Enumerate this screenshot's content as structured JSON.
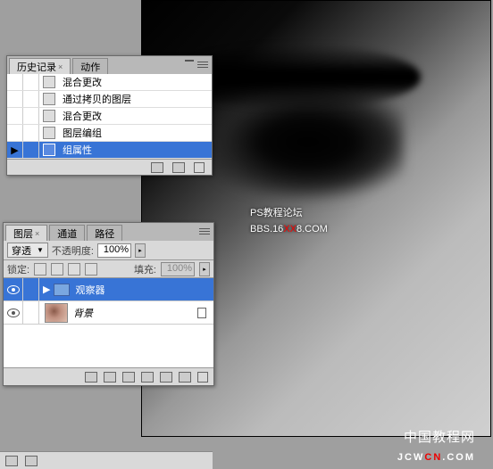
{
  "canvas": {
    "watermark_line1": "PS教程论坛",
    "watermark_line2a": "BBS.16",
    "watermark_line2b": "XX",
    "watermark_line2c": "8.COM",
    "footer_cn": "中国教程网",
    "footer_en_a": "JCW",
    "footer_en_b": "CN",
    "footer_en_c": ".COM"
  },
  "history": {
    "tab1": "历史记录",
    "tab2": "动作",
    "items": [
      {
        "label": "混合更改"
      },
      {
        "label": "通过拷贝的图层"
      },
      {
        "label": "混合更改"
      },
      {
        "label": "图层编组"
      },
      {
        "label": "组属性"
      }
    ]
  },
  "layers": {
    "tab1": "图层",
    "tab2": "通道",
    "tab3": "路径",
    "blend_label": "穿透",
    "opacity_label": "不透明度:",
    "opacity_value": "100%",
    "lock_label": "锁定:",
    "fill_label": "填充:",
    "fill_value": "100%",
    "items": [
      {
        "label": "观察器",
        "type": "folder"
      },
      {
        "label": "背景",
        "type": "layer"
      }
    ]
  }
}
